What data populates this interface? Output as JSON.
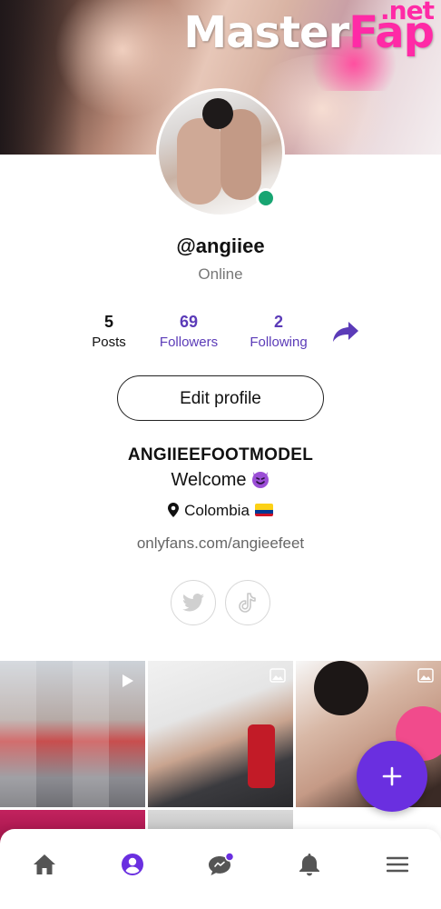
{
  "watermark": {
    "brand_a": "Master",
    "brand_b": "Fap",
    "tld": ".net"
  },
  "profile": {
    "username": "@angiiee",
    "status": "Online",
    "display_name": "ANGIIEEFOOTMODEL",
    "bio": "Welcome",
    "location": "Colombia",
    "link": "onlyfans.com/angieefeet"
  },
  "stats": {
    "posts": {
      "value": "5",
      "label": "Posts"
    },
    "followers": {
      "value": "69",
      "label": "Followers"
    },
    "following": {
      "value": "2",
      "label": "Following"
    }
  },
  "actions": {
    "edit_profile": "Edit profile"
  },
  "icons": {
    "share": "share-arrow-icon",
    "location": "map-pin-icon",
    "emoji": "smiling-devil-emoji",
    "flag": "colombia-flag",
    "socials": [
      "twitter-icon",
      "tiktok-icon"
    ],
    "fab": "plus-icon",
    "nav": [
      "home-icon",
      "profile-icon",
      "messages-icon",
      "notifications-icon",
      "menu-icon"
    ]
  },
  "colors": {
    "accent": "#5b3bb8",
    "fab": "#6a2fe0",
    "online": "#18a572"
  }
}
